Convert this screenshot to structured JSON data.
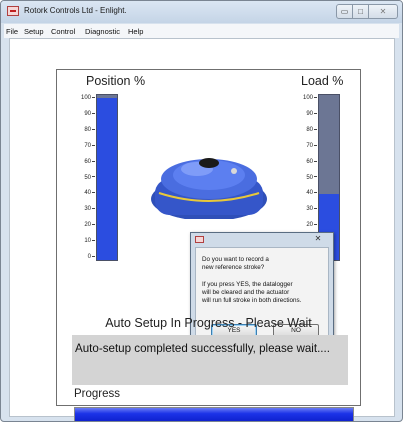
{
  "window": {
    "title": "Rotork Controls Ltd - Enlight.",
    "controls": {
      "minimize": "▭",
      "maximize": "□",
      "close": "✕"
    }
  },
  "menu": [
    "File",
    "Setup",
    "Control",
    "Diagnostic",
    "Help"
  ],
  "gauges": {
    "position": {
      "title": "Position %",
      "ticks": [
        "100",
        "90",
        "80",
        "70",
        "60",
        "50",
        "40",
        "30",
        "20",
        "10",
        "0"
      ],
      "value_percent": 98
    },
    "load": {
      "title": "Load %",
      "ticks": [
        "100",
        "90",
        "80",
        "70",
        "60",
        "50",
        "40",
        "30",
        "20",
        "10",
        "0"
      ],
      "value_percent": 40
    }
  },
  "dialog": {
    "close_label": "✕",
    "lines": [
      "Do you want to record a",
      "new reference stroke?",
      "If you press YES, the datalogger",
      "will be cleared and the actuator",
      "will run full stroke in both directions."
    ],
    "yes_label": "YES",
    "no_label": "NO"
  },
  "status": {
    "heading": "Auto Setup In Progress - Please Wait",
    "message": "Auto-setup completed successfully, please wait...."
  },
  "progress": {
    "label": "Progress",
    "value_percent": 100
  },
  "colors": {
    "gauge_fill": "#2b4de0",
    "gauge_empty": "#6c7694",
    "progress_fill": "#1c33e8"
  }
}
